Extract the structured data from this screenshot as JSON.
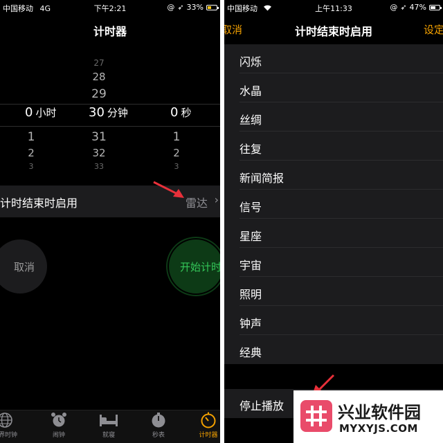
{
  "left_screen": {
    "status": {
      "carrier": "中国移动",
      "network": "4G",
      "time": "下午2:21",
      "battery": "33%"
    },
    "title": "计时器",
    "picker": {
      "hours": {
        "above": [
          "",
          "",
          ""
        ],
        "value": "0",
        "unit": "小时",
        "below": [
          "1",
          "2",
          "3"
        ]
      },
      "minutes": {
        "above": [
          "27",
          "28",
          "29"
        ],
        "value": "30",
        "unit": "分钟",
        "below": [
          "31",
          "32",
          "33"
        ]
      },
      "seconds": {
        "above": [
          "",
          "",
          ""
        ],
        "value": "0",
        "unit": "秒",
        "below": [
          "1",
          "2",
          "3"
        ]
      }
    },
    "when_ends": {
      "label": "计时结束时启用",
      "value": "雷达",
      "chevron": "›"
    },
    "cancel_label": "取消",
    "start_label": "开始计时",
    "tabs": [
      {
        "label": "世界时钟",
        "icon": "globe-icon"
      },
      {
        "label": "闹钟",
        "icon": "alarm-icon"
      },
      {
        "label": "就寝",
        "icon": "bed-icon"
      },
      {
        "label": "秒表",
        "icon": "stopwatch-icon"
      },
      {
        "label": "计时器",
        "icon": "timer-icon"
      }
    ],
    "active_tab": "计时器"
  },
  "right_screen": {
    "status": {
      "carrier": "中国移动",
      "time": "上午11:33",
      "battery": "47%"
    },
    "title": "计时结束时启用",
    "cancel_label": "取消",
    "set_label": "设定",
    "sounds": [
      "闪烁",
      "水晶",
      "丝绸",
      "往复",
      "新闻简报",
      "信号",
      "星座",
      "宇宙",
      "照明",
      "钟声",
      "经典"
    ],
    "stop_label": "停止播放"
  },
  "watermark": {
    "title": "兴业软件园",
    "subtitle": "MYXYJS.COM"
  },
  "colors": {
    "accent": "#f4a100",
    "start_green": "#34c759",
    "arrow_red": "#e8303a",
    "background": "#000000"
  }
}
